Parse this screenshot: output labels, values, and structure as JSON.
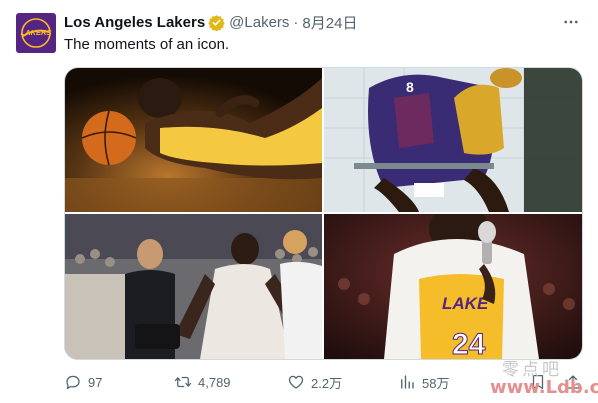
{
  "author": {
    "name": "Los Angeles Lakers",
    "handle": "@Lakers",
    "separator": "·",
    "date": "8月24日",
    "avatar_text": "LAKERS",
    "verified": true
  },
  "tweet_text": "The moments of an icon.",
  "media": {
    "photos": [
      {
        "subject": "player lying on court with basketball"
      },
      {
        "subject": "player seated with championship trophy"
      },
      {
        "subject": "player walking through crowd"
      },
      {
        "subject": "player with towel speaking into microphone"
      }
    ],
    "jersey_text": "LAKE",
    "jersey_number": "24",
    "number_8": "8"
  },
  "actions": {
    "replies": "97",
    "retweets": "4,789",
    "likes": "2.2万",
    "views": "58万"
  },
  "watermark": {
    "line1": "零点吧",
    "line2": "www.Ldb.cc"
  },
  "colors": {
    "lakers_purple": "#552583",
    "lakers_gold": "#fdb927",
    "verified_gold": "#e2b719",
    "secondary_text": "#536471"
  },
  "icons": [
    "verified-badge-icon",
    "more-icon",
    "reply-icon",
    "retweet-icon",
    "like-icon",
    "views-icon",
    "bookmark-icon",
    "share-icon"
  ]
}
